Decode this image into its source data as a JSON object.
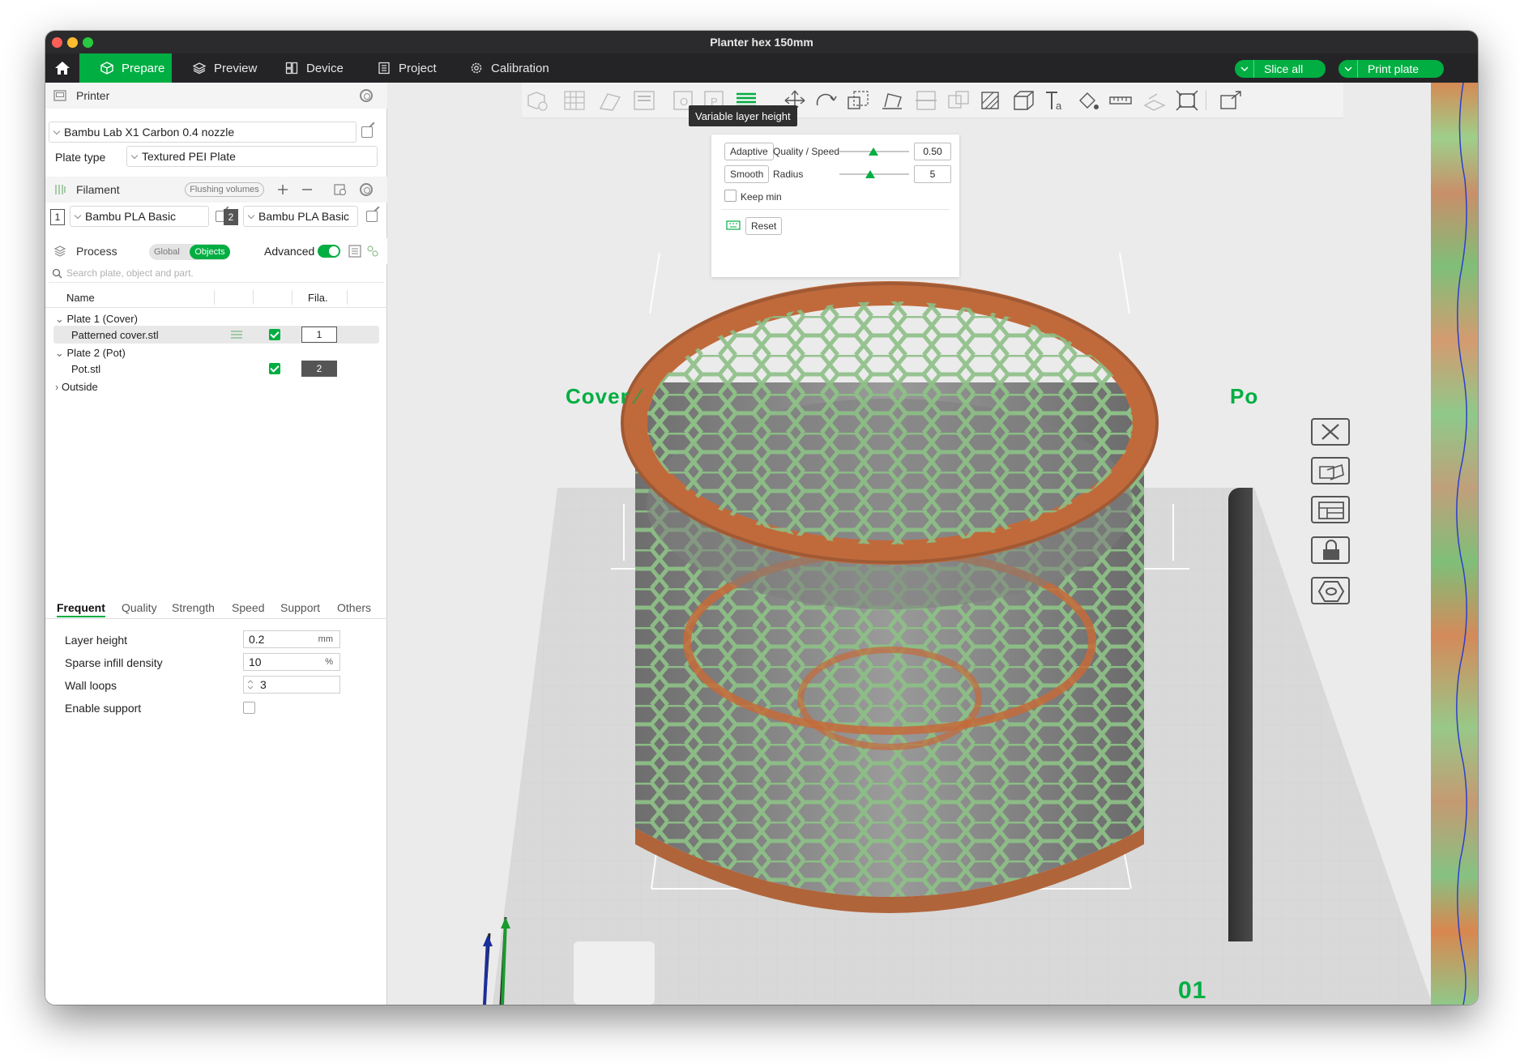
{
  "window": {
    "title": "Planter hex 150mm"
  },
  "nav": {
    "tabs": [
      {
        "label": "Prepare",
        "active": true
      },
      {
        "label": "Preview"
      },
      {
        "label": "Device"
      },
      {
        "label": "Project"
      },
      {
        "label": "Calibration"
      }
    ],
    "slice_label": "Slice all",
    "print_label": "Print plate"
  },
  "printer": {
    "header": "Printer",
    "selected": "Bambu Lab X1 Carbon 0.4 nozzle",
    "plate_type_label": "Plate type",
    "plate_type_value": "Textured PEI Plate"
  },
  "filament": {
    "header": "Filament",
    "flush_label": "Flushing volumes",
    "slots": [
      {
        "index": "1",
        "name": "Bambu PLA Basic"
      },
      {
        "index": "2",
        "name": "Bambu PLA Basic"
      }
    ]
  },
  "process": {
    "header": "Process",
    "toggle_global": "Global",
    "toggle_objects": "Objects",
    "advanced_label": "Advanced",
    "search_placeholder": "Search plate, object and part.",
    "col_name": "Name",
    "col_fila": "Fila.",
    "tree": [
      {
        "label": "Plate 1 (Cover)",
        "type": "plate"
      },
      {
        "label": "Patterned cover.stl",
        "type": "object",
        "fila": "1"
      },
      {
        "label": "Plate 2 (Pot)",
        "type": "plate"
      },
      {
        "label": "Pot.stl",
        "type": "object",
        "fila": "2"
      },
      {
        "label": "Outside",
        "type": "plate"
      }
    ],
    "tabs": [
      "Frequent",
      "Quality",
      "Strength",
      "Speed",
      "Support",
      "Others"
    ],
    "params": [
      {
        "label": "Layer height",
        "value": "0.2",
        "unit": "mm"
      },
      {
        "label": "Sparse infill density",
        "value": "10",
        "unit": "%"
      },
      {
        "label": "Wall loops",
        "value": "3",
        "unit": ""
      },
      {
        "label": "Enable support",
        "value": "",
        "unit": ""
      }
    ]
  },
  "viewport": {
    "tooltip": "Variable layer height",
    "vlh": {
      "adaptive_label": "Adaptive",
      "quality_label": "Quality / Speed",
      "quality_value": "0.50",
      "smooth_label": "Smooth",
      "radius_label": "Radius",
      "radius_value": "5",
      "keepmin_label": "Keep min",
      "reset_label": "Reset"
    },
    "plate_labels": [
      "Cover",
      "Po"
    ],
    "plate_number": "01"
  },
  "colors": {
    "accent": "#00ae42",
    "dark": "#242427",
    "orange": "#c56b3a"
  }
}
